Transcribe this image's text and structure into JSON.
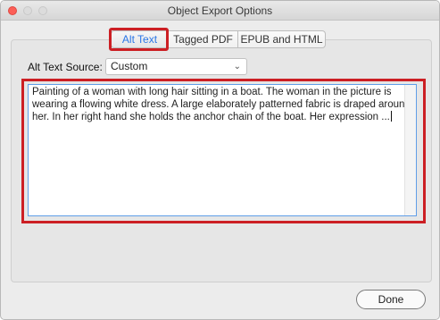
{
  "window": {
    "title": "Object Export Options"
  },
  "tabs": [
    {
      "label": "Alt Text",
      "selected": true
    },
    {
      "label": "Tagged PDF",
      "selected": false
    },
    {
      "label": "EPUB and HTML",
      "selected": false
    }
  ],
  "alt_text_source": {
    "label": "Alt Text Source:",
    "value": "Custom"
  },
  "alt_text": {
    "value": "Painting of a woman with long hair sitting in a boat. The woman in the picture is wearing a flowing white dress. A large elaborately patterned fabric is draped around her. In her right hand she holds the anchor chain of the boat. Her expression ..."
  },
  "buttons": {
    "done": "Done"
  },
  "colors": {
    "highlight": "#cc1f24",
    "selected_tab_text": "#2b77e7",
    "focus_ring": "#5f9ee8"
  },
  "icons": [
    "close-icon",
    "minimize-icon",
    "maximize-icon",
    "chevron-down-icon"
  ]
}
